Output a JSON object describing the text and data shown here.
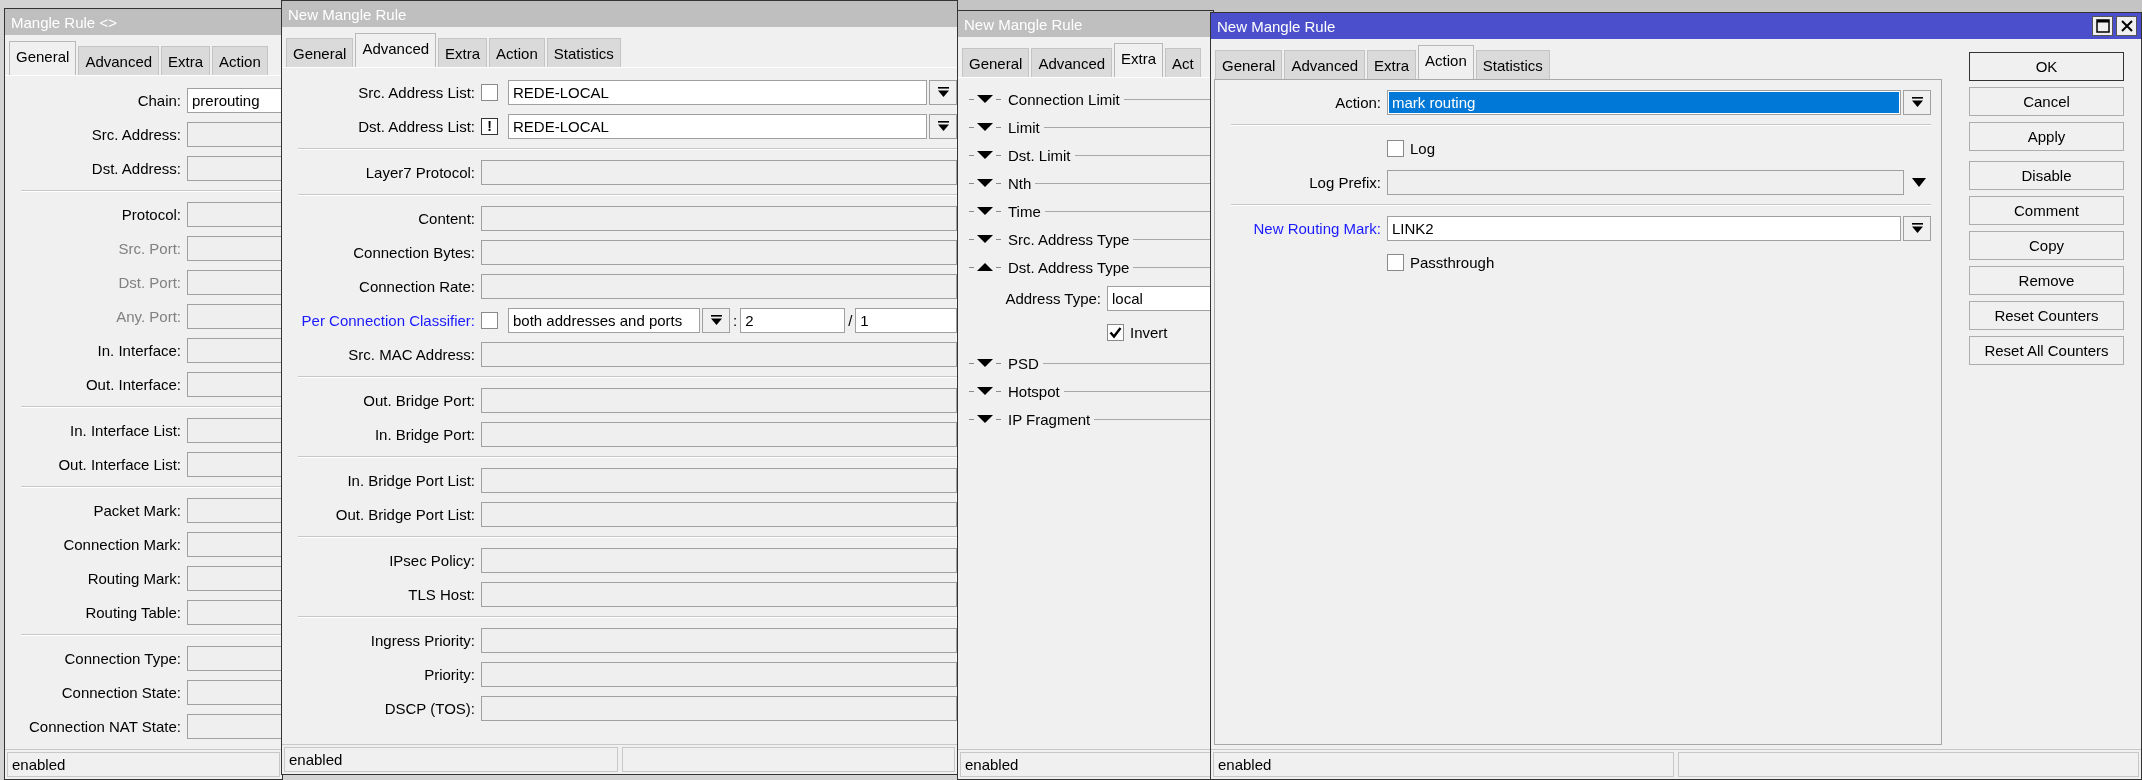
{
  "windows": [
    {
      "title": "Mangle Rule <>",
      "active": false,
      "window_buttons": false,
      "tabs": [
        {
          "label": "General",
          "selected": true
        },
        {
          "label": "Advanced",
          "selected": false
        },
        {
          "label": "Extra",
          "selected": false
        },
        {
          "label": "Action",
          "selected": false
        }
      ],
      "rows": [
        {
          "kind": "field",
          "label": "Chain:",
          "value": "prerouting",
          "disabled": false,
          "changed": false
        },
        {
          "kind": "field",
          "label": "Src. Address:",
          "disabled": false,
          "changed": false
        },
        {
          "kind": "field",
          "label": "Dst. Address:",
          "disabled": false,
          "changed": false
        },
        {
          "kind": "separator"
        },
        {
          "kind": "field",
          "label": "Protocol:",
          "disabled": false,
          "changed": false
        },
        {
          "kind": "field",
          "label": "Src. Port:",
          "disabled": true,
          "changed": false
        },
        {
          "kind": "field",
          "label": "Dst. Port:",
          "disabled": true,
          "changed": false
        },
        {
          "kind": "field",
          "label": "Any. Port:",
          "disabled": true,
          "changed": false
        },
        {
          "kind": "field",
          "label": "In. Interface:",
          "disabled": false,
          "changed": false
        },
        {
          "kind": "field",
          "label": "Out. Interface:",
          "disabled": false,
          "changed": false
        },
        {
          "kind": "separator"
        },
        {
          "kind": "field",
          "label": "In. Interface List:",
          "disabled": false,
          "changed": false
        },
        {
          "kind": "field",
          "label": "Out. Interface List:",
          "disabled": false,
          "changed": false
        },
        {
          "kind": "separator"
        },
        {
          "kind": "field",
          "label": "Packet Mark:",
          "disabled": false,
          "changed": false
        },
        {
          "kind": "field",
          "label": "Connection Mark:",
          "disabled": false,
          "changed": false
        },
        {
          "kind": "field",
          "label": "Routing Mark:",
          "disabled": false,
          "changed": false
        },
        {
          "kind": "field",
          "label": "Routing Table:",
          "disabled": false,
          "changed": false
        },
        {
          "kind": "separator"
        },
        {
          "kind": "field",
          "label": "Connection Type:",
          "disabled": false,
          "changed": false
        },
        {
          "kind": "field",
          "label": "Connection State:",
          "disabled": false,
          "changed": false
        },
        {
          "kind": "field",
          "label": "Connection NAT State:",
          "disabled": false,
          "changed": false
        }
      ],
      "status": "enabled"
    },
    {
      "title": "New Mangle Rule",
      "active": false,
      "window_buttons": false,
      "tabs": [
        {
          "label": "General",
          "selected": false
        },
        {
          "label": "Advanced",
          "selected": true
        },
        {
          "label": "Extra",
          "selected": false
        },
        {
          "label": "Action",
          "selected": false
        },
        {
          "label": "Statistics",
          "selected": false
        }
      ],
      "rows": [
        {
          "kind": "select_field",
          "label": "Src. Address List:",
          "negate": {
            "checked": false
          },
          "value": "REDE-LOCAL",
          "disabled": false,
          "changed": false
        },
        {
          "kind": "select_field",
          "label": "Dst. Address List:",
          "negate": {
            "checked": true,
            "symbol": "!"
          },
          "value": "REDE-LOCAL",
          "disabled": false,
          "changed": false
        },
        {
          "kind": "separator"
        },
        {
          "kind": "field",
          "label": "Layer7 Protocol:",
          "disabled": false,
          "changed": false
        },
        {
          "kind": "separator"
        },
        {
          "kind": "field",
          "label": "Content:",
          "disabled": false,
          "changed": false
        },
        {
          "kind": "field",
          "label": "Connection Bytes:",
          "disabled": false,
          "changed": false
        },
        {
          "kind": "field",
          "label": "Connection Rate:",
          "disabled": false,
          "changed": false
        },
        {
          "kind": "pcc",
          "label": "Per Connection Classifier:",
          "disabled": false,
          "changed": true,
          "negate": {
            "checked": false
          },
          "value": "both addresses and ports",
          "separator_1": ":",
          "field_2": "2",
          "separator_2": "/",
          "field_3": "1"
        },
        {
          "kind": "field",
          "label": "Src. MAC Address:",
          "disabled": false,
          "changed": false
        },
        {
          "kind": "separator"
        },
        {
          "kind": "field",
          "label": "Out. Bridge Port:",
          "disabled": false,
          "changed": false
        },
        {
          "kind": "field",
          "label": "In. Bridge Port:",
          "disabled": false,
          "changed": false
        },
        {
          "kind": "separator"
        },
        {
          "kind": "field",
          "label": "In. Bridge Port List:",
          "disabled": false,
          "changed": false
        },
        {
          "kind": "field",
          "label": "Out. Bridge Port List:",
          "disabled": false,
          "changed": false
        },
        {
          "kind": "separator"
        },
        {
          "kind": "field",
          "label": "IPsec Policy:",
          "disabled": false,
          "changed": false
        },
        {
          "kind": "field",
          "label": "TLS Host:",
          "disabled": false,
          "changed": false
        },
        {
          "kind": "separator"
        },
        {
          "kind": "field",
          "label": "Ingress Priority:",
          "disabled": false,
          "changed": false
        },
        {
          "kind": "field",
          "label": "Priority:",
          "disabled": false,
          "changed": false
        },
        {
          "kind": "field",
          "label": "DSCP (TOS):",
          "disabled": false,
          "changed": false
        }
      ],
      "status": "enabled"
    },
    {
      "title": "New Mangle Rule",
      "active": false,
      "window_buttons": false,
      "tabs": [
        {
          "label": "General",
          "selected": false
        },
        {
          "label": "Advanced",
          "selected": false
        },
        {
          "label": "Extra",
          "selected": true
        },
        {
          "label": "Act",
          "selected": false
        }
      ],
      "rows": [
        {
          "kind": "section",
          "label": "Connection Limit",
          "expanded": false
        },
        {
          "kind": "section",
          "label": "Limit",
          "expanded": false
        },
        {
          "kind": "section",
          "label": "Dst. Limit",
          "expanded": false
        },
        {
          "kind": "section",
          "label": "Nth",
          "expanded": false
        },
        {
          "kind": "section",
          "label": "Time",
          "expanded": false
        },
        {
          "kind": "section",
          "label": "Src. Address Type",
          "expanded": false
        },
        {
          "kind": "section",
          "label": "Dst. Address Type",
          "expanded": true,
          "children": [
            {
              "kind": "field",
              "label": "Address Type:",
              "value": "local",
              "disabled": false,
              "changed": false
            },
            {
              "kind": "checkbox",
              "label": "Invert",
              "checked": true
            }
          ]
        },
        {
          "kind": "section",
          "label": "PSD",
          "expanded": false
        },
        {
          "kind": "section",
          "label": "Hotspot",
          "expanded": false
        },
        {
          "kind": "section",
          "label": "IP Fragment",
          "expanded": false
        }
      ],
      "status": "enabled"
    },
    {
      "title": "New Mangle Rule",
      "active": true,
      "window_buttons": true,
      "tabs": [
        {
          "label": "General",
          "selected": false
        },
        {
          "label": "Advanced",
          "selected": false
        },
        {
          "label": "Extra",
          "selected": false
        },
        {
          "label": "Action",
          "selected": true
        },
        {
          "label": "Statistics",
          "selected": false
        }
      ],
      "rows": [
        {
          "kind": "select_field",
          "label": "Action:",
          "value": "mark routing",
          "text_selected": true,
          "disabled": false,
          "changed": false
        },
        {
          "kind": "separator"
        },
        {
          "kind": "checkbox",
          "label": "Log",
          "checked": false
        },
        {
          "kind": "menu_field",
          "label": "Log Prefix:",
          "text_selected": false,
          "disabled": false,
          "changed": false
        },
        {
          "kind": "separator"
        },
        {
          "kind": "select_field",
          "label": "New Routing Mark:",
          "value": "LINK2",
          "text_selected": false,
          "disabled": false,
          "changed": true
        },
        {
          "kind": "checkbox",
          "label": "Passthrough",
          "checked": false
        }
      ],
      "button_groups": [
        [
          "OK",
          "Cancel",
          "Apply"
        ],
        [
          "Disable",
          "Comment",
          "Copy",
          "Remove",
          "Reset Counters",
          "Reset All Counters"
        ]
      ],
      "status": "enabled"
    }
  ]
}
